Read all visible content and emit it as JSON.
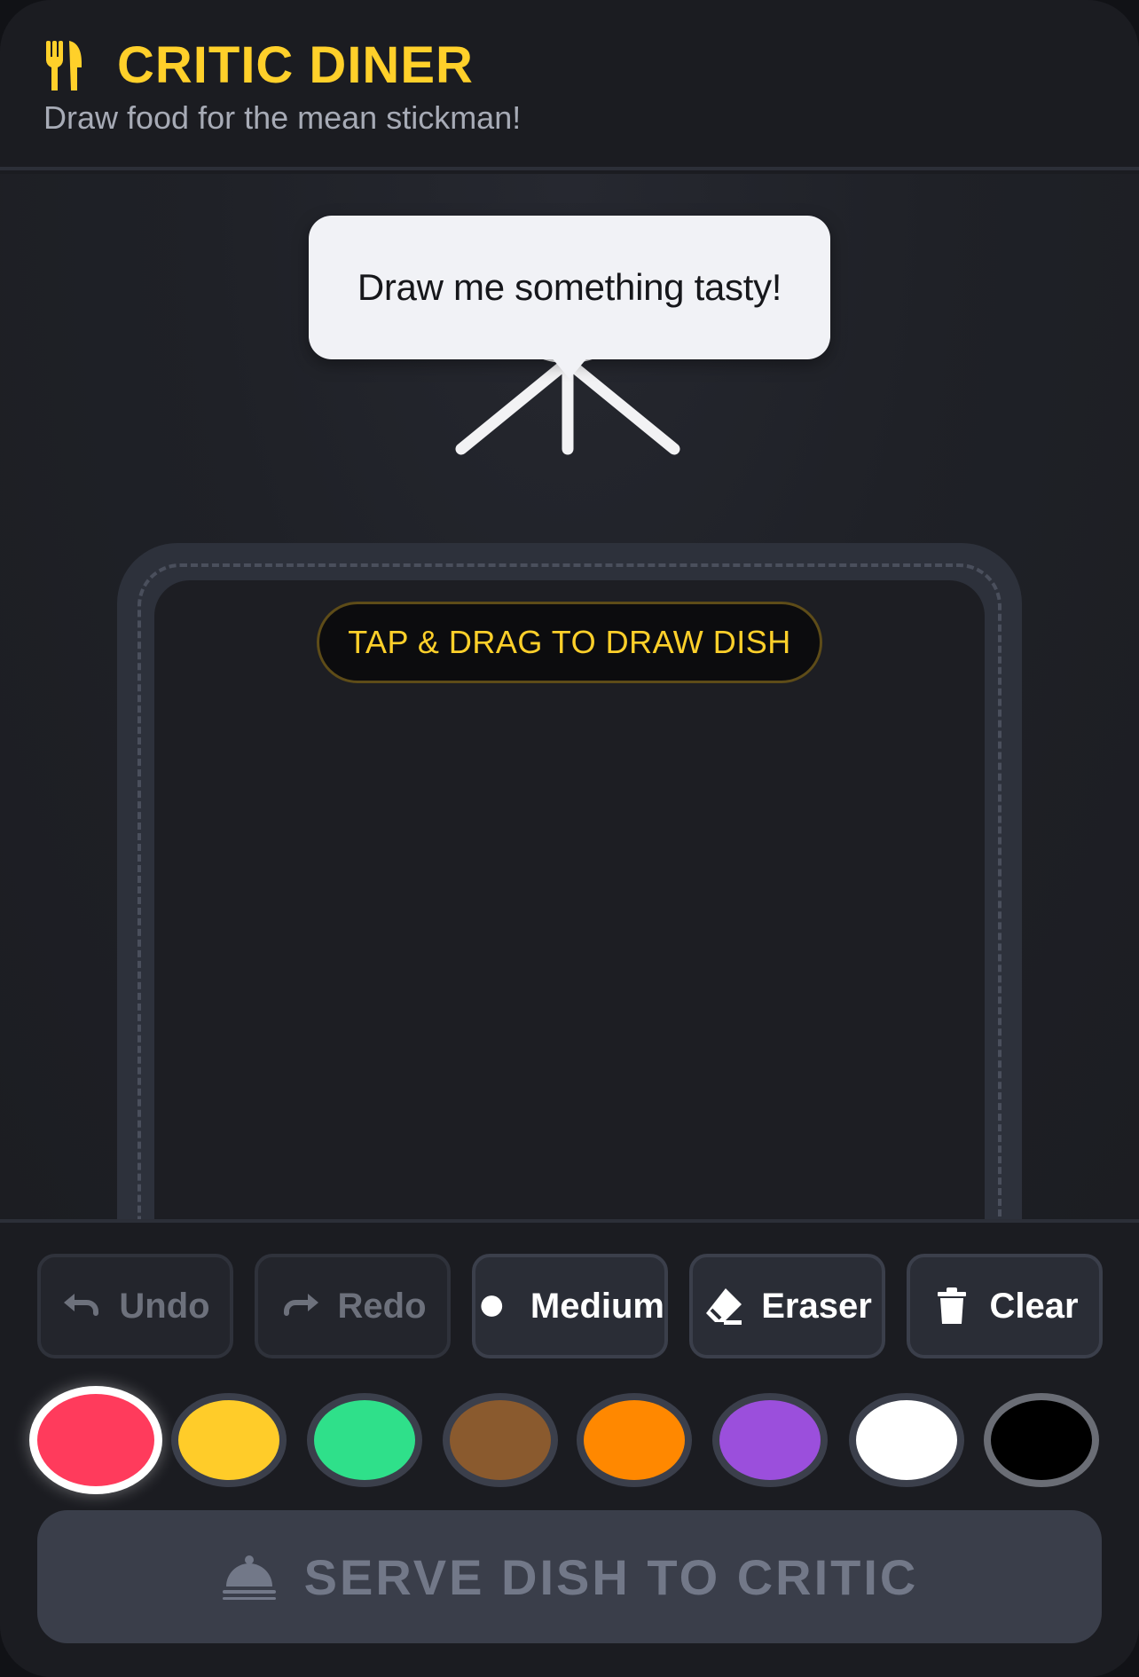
{
  "header": {
    "title": "CRITIC DINER",
    "subtitle": "Draw food for the mean stickman!",
    "icon": "fork-knife-icon"
  },
  "critic": {
    "speech": "Draw me something tasty!"
  },
  "canvas": {
    "hint": "TAP & DRAG TO DRAW DISH"
  },
  "tools": {
    "undo": {
      "label": "Undo",
      "icon": "undo-icon",
      "enabled": false
    },
    "redo": {
      "label": "Redo",
      "icon": "redo-icon",
      "enabled": false
    },
    "brush": {
      "label": "Medium",
      "icon": "brush-size-dot-icon"
    },
    "eraser": {
      "label": "Eraser",
      "icon": "eraser-icon"
    },
    "clear": {
      "label": "Clear",
      "icon": "trash-icon"
    }
  },
  "palette": {
    "selected": "red",
    "colors": [
      {
        "name": "red",
        "hex": "#ff3b5c"
      },
      {
        "name": "yellow",
        "hex": "#ffcc29"
      },
      {
        "name": "green",
        "hex": "#2fe08a"
      },
      {
        "name": "brown",
        "hex": "#8a5a2e"
      },
      {
        "name": "orange",
        "hex": "#ff8800"
      },
      {
        "name": "purple",
        "hex": "#9b4fdc"
      },
      {
        "name": "white",
        "hex": "#ffffff"
      },
      {
        "name": "black",
        "hex": "#000000"
      }
    ]
  },
  "serve": {
    "label": "SERVE DISH TO CRITIC",
    "icon": "cloche-icon",
    "enabled": false
  },
  "colors": {
    "accent": "#ffd02a",
    "background": "#1b1c21"
  }
}
